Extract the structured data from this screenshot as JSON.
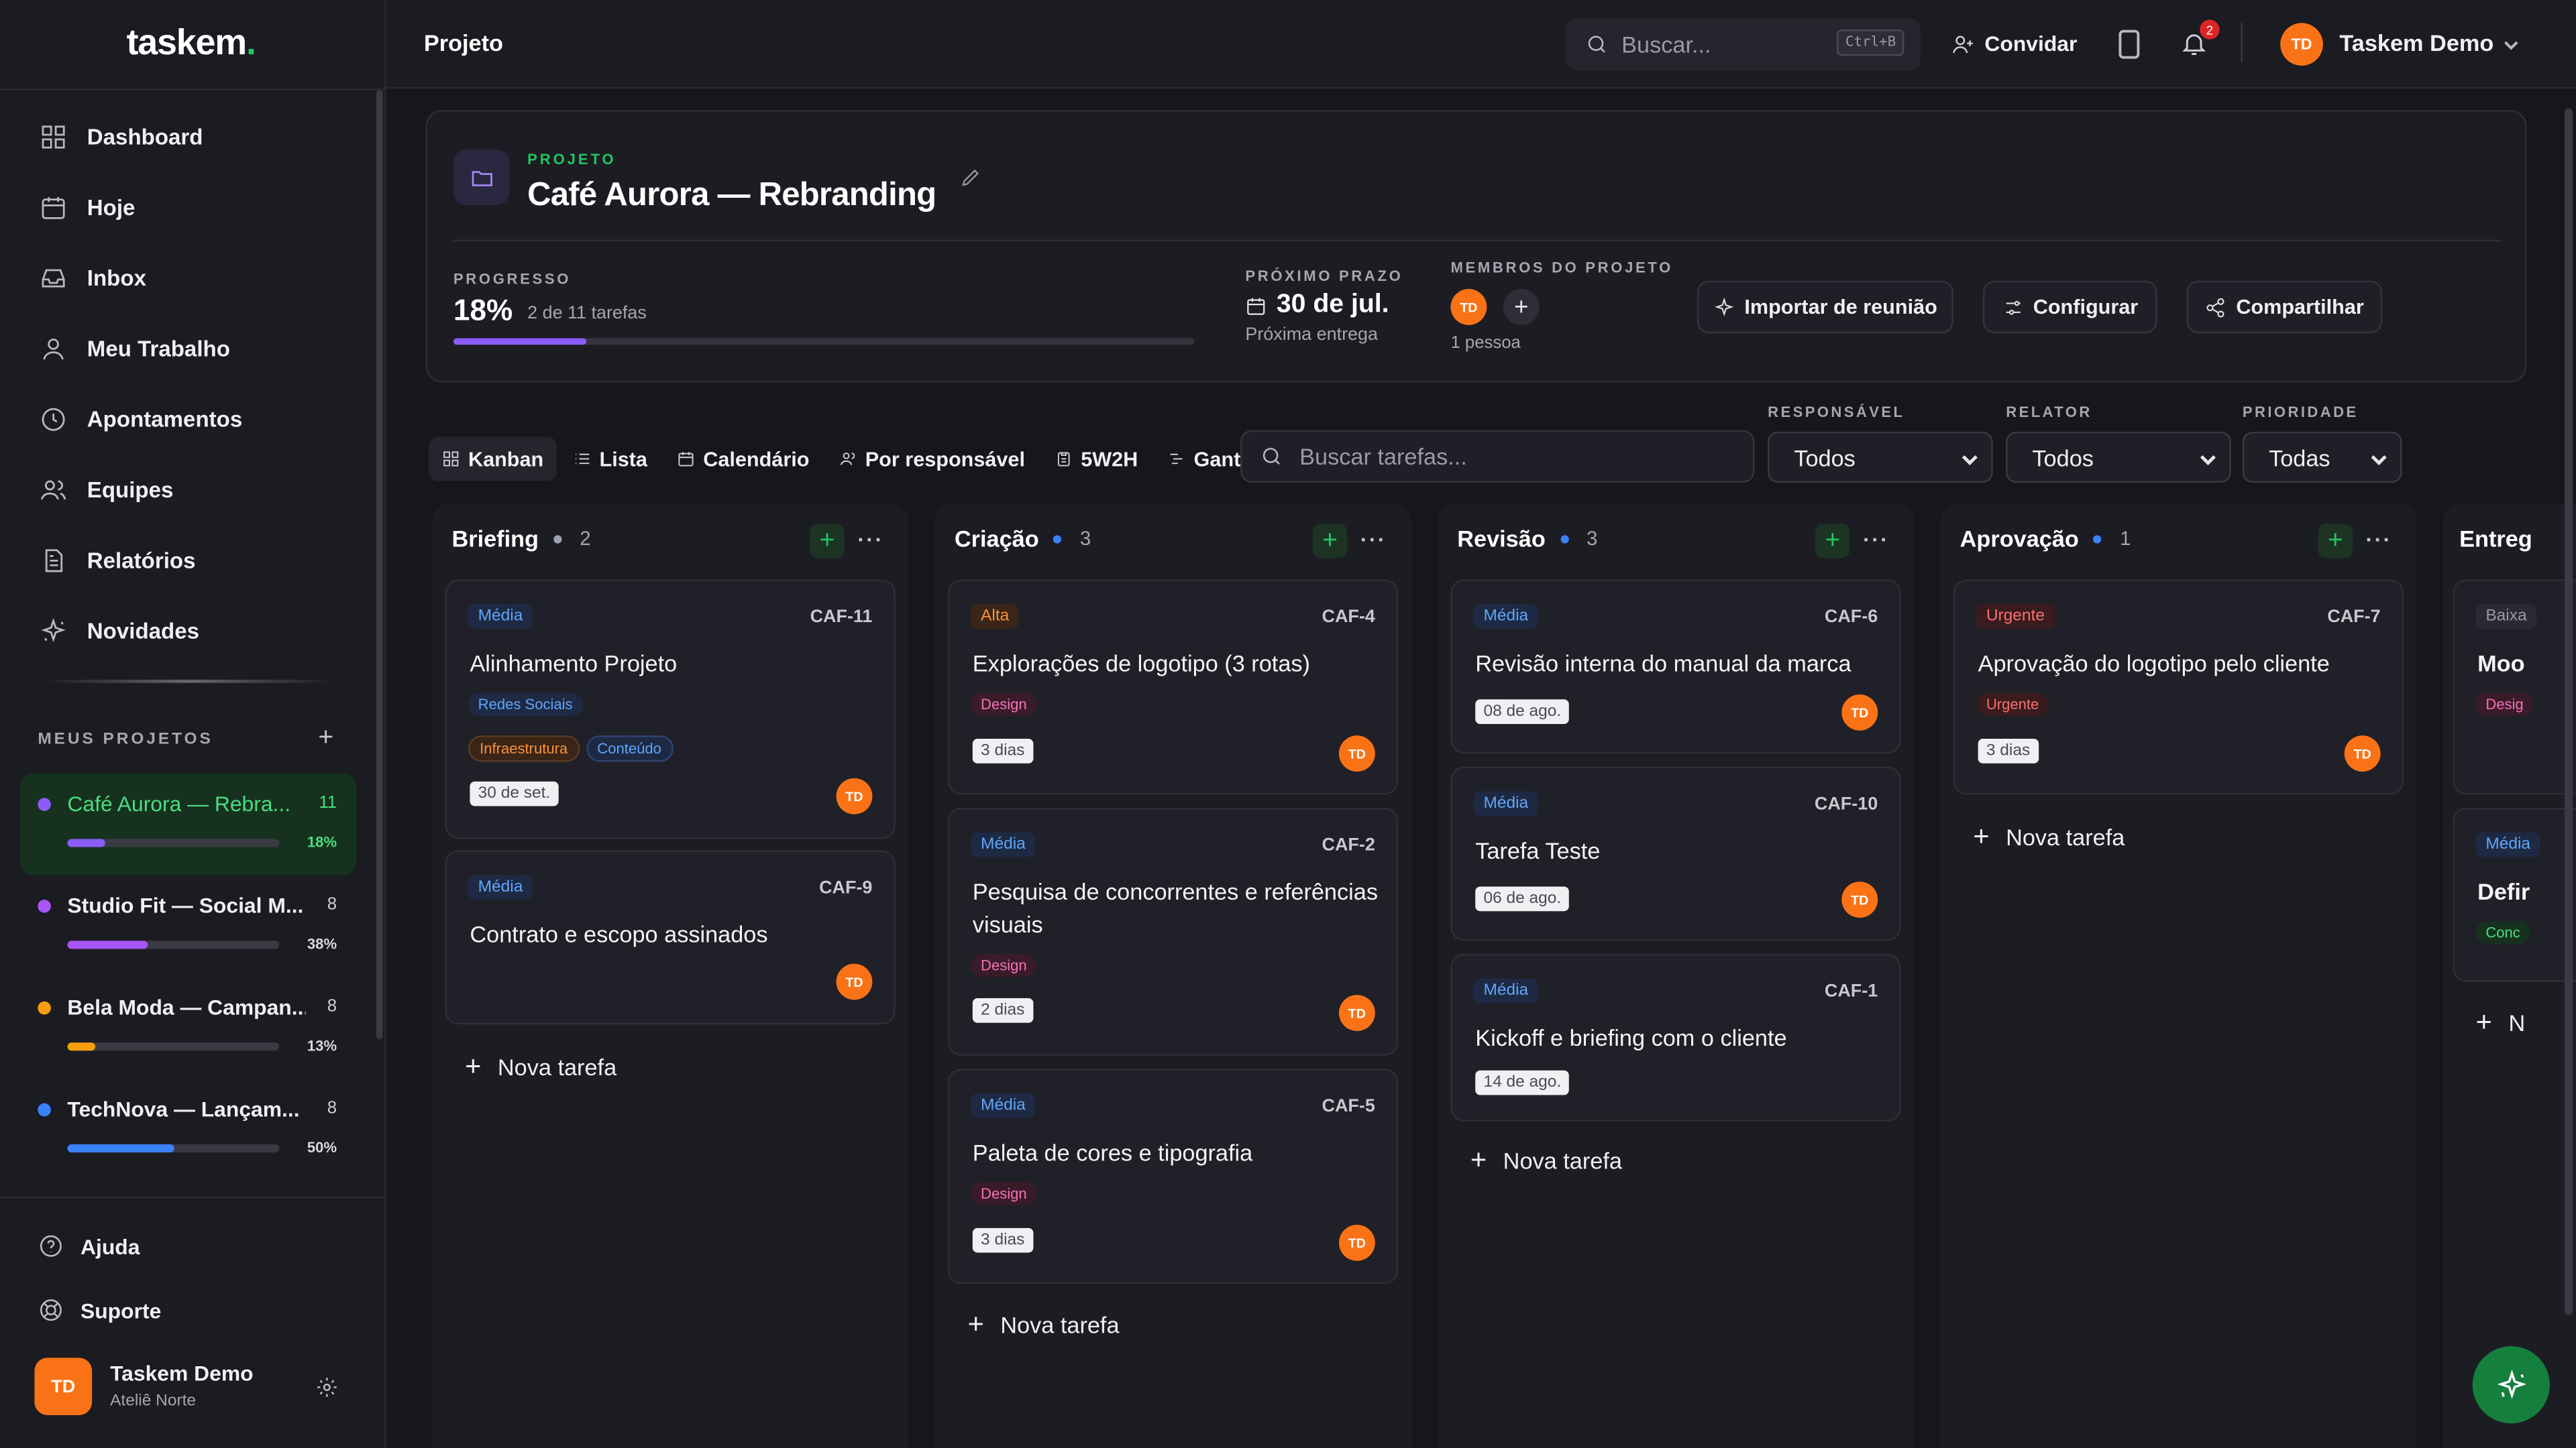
{
  "app": {
    "logo": "taskem",
    "logo_dot": "."
  },
  "sidebar": {
    "nav": [
      {
        "label": "Dashboard",
        "icon": "dashboard-icon"
      },
      {
        "label": "Hoje",
        "icon": "calendar-icon"
      },
      {
        "label": "Inbox",
        "icon": "inbox-icon"
      },
      {
        "label": "Meu Trabalho",
        "icon": "user-icon"
      },
      {
        "label": "Apontamentos",
        "icon": "clock-icon"
      },
      {
        "label": "Equipes",
        "icon": "users-icon"
      },
      {
        "label": "Relatórios",
        "icon": "report-icon"
      },
      {
        "label": "Novidades",
        "icon": "sparkle-icon"
      }
    ],
    "projects_heading": "MEUS PROJETOS",
    "projects": [
      {
        "name": "Café Aurora — Rebra...",
        "count": "11",
        "pct": "18%",
        "progress": 0.18,
        "color": "#8b5cf6"
      },
      {
        "name": "Studio Fit — Social M...",
        "count": "8",
        "pct": "38%",
        "progress": 0.38,
        "color": "#a855f7"
      },
      {
        "name": "Bela Moda — Campan...",
        "count": "8",
        "pct": "13%",
        "progress": 0.13,
        "color": "#f59e0b"
      },
      {
        "name": "TechNova — Lançam...",
        "count": "8",
        "pct": "50%",
        "progress": 0.5,
        "color": "#3b82f6"
      }
    ],
    "help": "Ajuda",
    "support": "Suporte",
    "user": {
      "initials": "TD",
      "name": "Taskem Demo",
      "org": "Ateliê Norte"
    }
  },
  "topbar": {
    "title": "Projeto",
    "search_placeholder": "Buscar...",
    "search_shortcut": "Ctrl+B",
    "invite": "Convidar",
    "notifications": "2",
    "user_initials": "TD",
    "user_name": "Taskem Demo"
  },
  "project": {
    "label": "PROJETO",
    "title": "Café Aurora — Rebranding",
    "progress_label": "PROGRESSO",
    "progress_value": "18%",
    "progress_fraction": 0.18,
    "progress_sub": "2 de 11 tarefas",
    "due_label": "PRÓXIMO PRAZO",
    "due_value": "30 de jul.",
    "due_sub": "Próxima entrega",
    "members_label": "MEMBROS DO PROJETO",
    "member_initials": "TD",
    "members_sub": "1 pessoa",
    "buttons": {
      "import": "Importar de reunião",
      "configure": "Configurar",
      "share": "Compartilhar"
    }
  },
  "views": {
    "tabs": [
      "Kanban",
      "Lista",
      "Calendário",
      "Por responsável",
      "5W2H",
      "Gantt"
    ],
    "search_placeholder": "Buscar tarefas...",
    "filters": [
      {
        "label": "RESPONSÁVEL",
        "value": "Todos"
      },
      {
        "label": "RELATOR",
        "value": "Todos"
      },
      {
        "label": "PRIORIDADE",
        "value": "Todas"
      }
    ]
  },
  "board": {
    "new_task": "Nova tarefa",
    "columns": [
      {
        "title": "Briefing",
        "count": "2",
        "dot": "#9ca3af",
        "cards": [
          {
            "prio": "Média",
            "id": "CAF-11",
            "title": "Alinhamento Projeto",
            "tags": [
              "Redes Sociais",
              "Infraestrutura",
              "Conteúdo"
            ],
            "date": "30 de set.",
            "av": "TD"
          },
          {
            "prio": "Média",
            "id": "CAF-9",
            "title": "Contrato e escopo assinados",
            "av": "TD"
          }
        ]
      },
      {
        "title": "Criação",
        "count": "3",
        "dot": "#3b82f6",
        "cards": [
          {
            "prio": "Alta",
            "id": "CAF-4",
            "title": "Explorações de logotipo (3 rotas)",
            "tags": [
              "Design"
            ],
            "date": "3 dias",
            "av": "TD"
          },
          {
            "prio": "Média",
            "id": "CAF-2",
            "title": "Pesquisa de concorrentes e referências visuais",
            "tags": [
              "Design"
            ],
            "date": "2 dias",
            "av": "TD"
          },
          {
            "prio": "Média",
            "id": "CAF-5",
            "title": "Paleta de cores e tipografia",
            "tags": [
              "Design"
            ],
            "date": "3 dias",
            "av": "TD"
          }
        ]
      },
      {
        "title": "Revisão",
        "count": "3",
        "dot": "#3b82f6",
        "cards": [
          {
            "prio": "Média",
            "id": "CAF-6",
            "title": "Revisão interna do manual da marca",
            "date": "08 de ago.",
            "av": "TD"
          },
          {
            "prio": "Média",
            "id": "CAF-10",
            "title": "Tarefa Teste",
            "date": "06 de ago.",
            "av": "TD"
          },
          {
            "prio": "Média",
            "id": "CAF-1",
            "title": "Kickoff e briefing com o cliente",
            "date": "14 de ago."
          }
        ]
      },
      {
        "title": "Aprovação",
        "count": "1",
        "dot": "#3b82f6",
        "cards": [
          {
            "prio": "Urgente",
            "id": "CAF-7",
            "title": "Aprovação do logotipo pelo cliente",
            "tags": [
              "Urgente"
            ],
            "date": "3 dias",
            "av": "TD"
          }
        ]
      },
      {
        "title": "Entreg",
        "cards": [
          {
            "prio": "Baixa",
            "title": "Moo",
            "tags": [
              "Desig"
            ]
          },
          {
            "prio": "Média",
            "title": "Defir",
            "tags": [
              "Conc"
            ]
          }
        ],
        "new_task_short": "N"
      }
    ]
  }
}
